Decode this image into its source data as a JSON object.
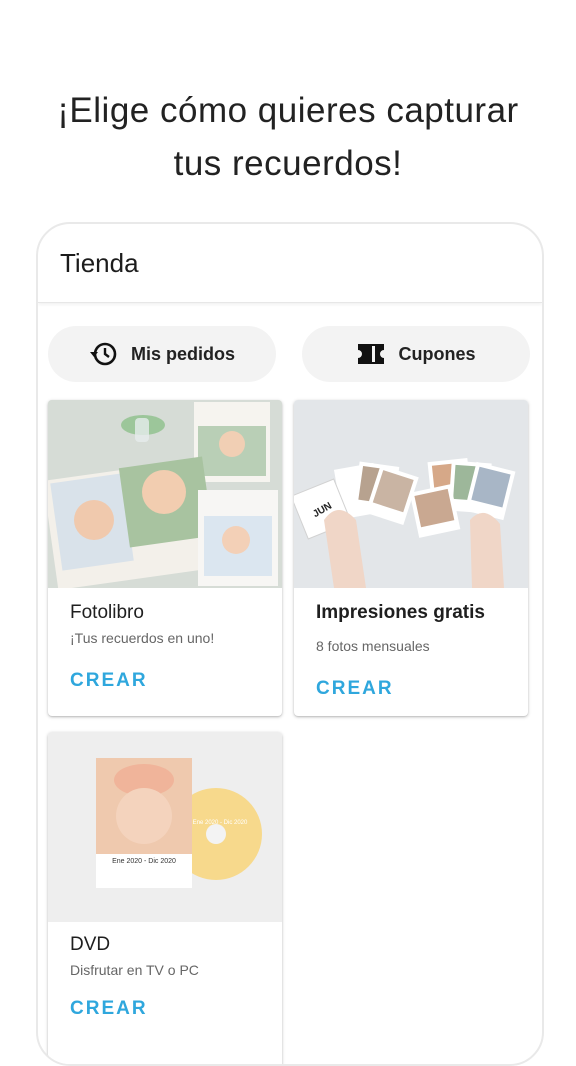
{
  "headline": {
    "line1": "¡Elige cómo quieres capturar",
    "line2": "tus recuerdos!"
  },
  "appbar": {
    "title": "Tienda"
  },
  "actions": {
    "orders_label": "Mis pedidos",
    "orders_icon": "history-icon",
    "coupons_label": "Cupones",
    "coupons_icon": "ticket-icon"
  },
  "products": [
    {
      "title": "Fotolibro",
      "subtitle": "¡Tus recuerdos en uno!",
      "cta": "CREAR",
      "image": "photobook-image"
    },
    {
      "title": "Impresiones gratis",
      "subtitle": "8 fotos mensuales",
      "cta": "CREAR",
      "image": "prints-image",
      "print_label": "JUN"
    },
    {
      "title": "DVD",
      "subtitle": "Disfrutar en TV o PC",
      "cta": "CREAR",
      "image": "dvd-image",
      "cover_text": "Ene 2020 - Dic 2020",
      "disc_text": "Ene 2020 - Dic 2020"
    }
  ],
  "colors": {
    "accent": "#2fa7dd",
    "pill_bg": "#f3f3f3"
  }
}
